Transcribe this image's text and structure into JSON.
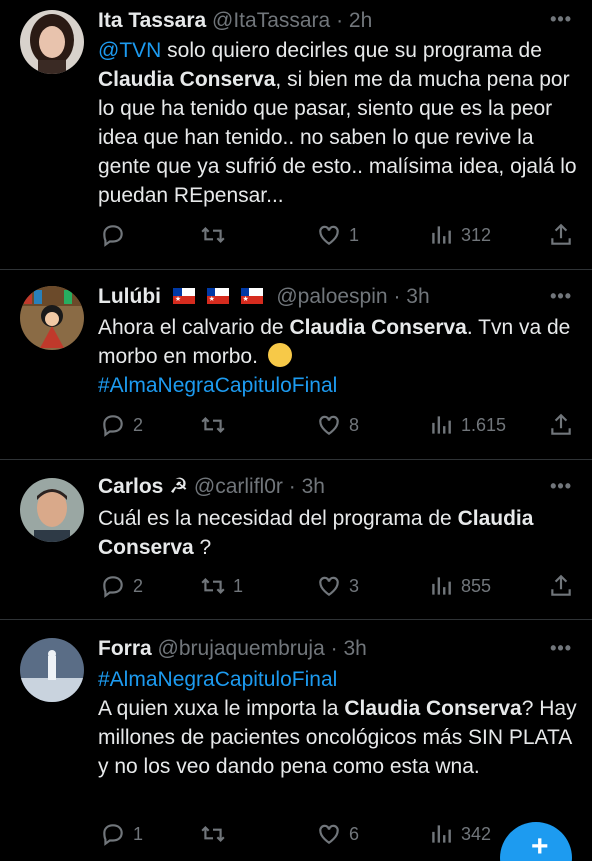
{
  "tweets": [
    {
      "name": "Ita Tassara",
      "handle": "@ItaTassara",
      "sep": "·",
      "time": "2h",
      "text": [
        {
          "t": "@TVN",
          "s": "link"
        },
        {
          "t": " solo quiero decirles que su programa de ",
          "s": "plain"
        },
        {
          "t": "Claudia Conserva",
          "s": "bold"
        },
        {
          "t": ", si bien me da mucha pena por lo que ha tenido que pasar, siento que es la peor idea que han tenido.. no saben lo que revive la gente que ya sufrió de esto.. malísima idea, ojalá lo puedan REpensar...",
          "s": "plain"
        }
      ],
      "replies": "",
      "retweets": "",
      "likes": "1",
      "views": "312"
    },
    {
      "name": "Lulúbi",
      "handle": "@paloespin",
      "sep": "·",
      "time": "3h",
      "text": [
        {
          "t": "Ahora el calvario de ",
          "s": "plain"
        },
        {
          "t": "Claudia Conserva",
          "s": "bold"
        },
        {
          "t": ". Tvn va de morbo en morbo. ",
          "s": "plain"
        },
        {
          "t": "\n",
          "s": "plain"
        },
        {
          "t": "#AlmaNegraCapituloFinal",
          "s": "link"
        }
      ],
      "replies": "2",
      "retweets": "",
      "likes": "8",
      "views": "1.615"
    },
    {
      "name": "Carlos ☭",
      "handle": "@carlifl0r",
      "sep": "·",
      "time": "3h",
      "text": [
        {
          "t": "Cuál es la necesidad del programa de ",
          "s": "plain"
        },
        {
          "t": "Claudia Conserva",
          "s": "bold"
        },
        {
          "t": " ?",
          "s": "plain"
        }
      ],
      "replies": "2",
      "retweets": "1",
      "likes": "3",
      "views": "855"
    },
    {
      "name": "Forra",
      "handle": "@brujaquembruja",
      "sep": "·",
      "time": "3h",
      "text": [
        {
          "t": "#AlmaNegraCapituloFinal",
          "s": "link"
        },
        {
          "t": "\nA quien xuxa le importa la ",
          "s": "plain"
        },
        {
          "t": "Claudia Conserva",
          "s": "bold"
        },
        {
          "t": "? Hay millones de pacientes oncológicos más SIN PLATA y no los veo dando pena como esta wna.",
          "s": "plain"
        }
      ],
      "replies": "1",
      "retweets": "",
      "likes": "6",
      "views": "342"
    }
  ],
  "more_label": "•••",
  "fab_label": "+",
  "colors": {
    "background": "#000000",
    "text": "#e7e9ea",
    "muted": "#71767b",
    "link": "#1d9bf0",
    "divider": "#2f3336"
  },
  "icons": [
    "reply-icon",
    "retweet-icon",
    "like-icon",
    "views-icon",
    "share-icon",
    "more-icon"
  ]
}
